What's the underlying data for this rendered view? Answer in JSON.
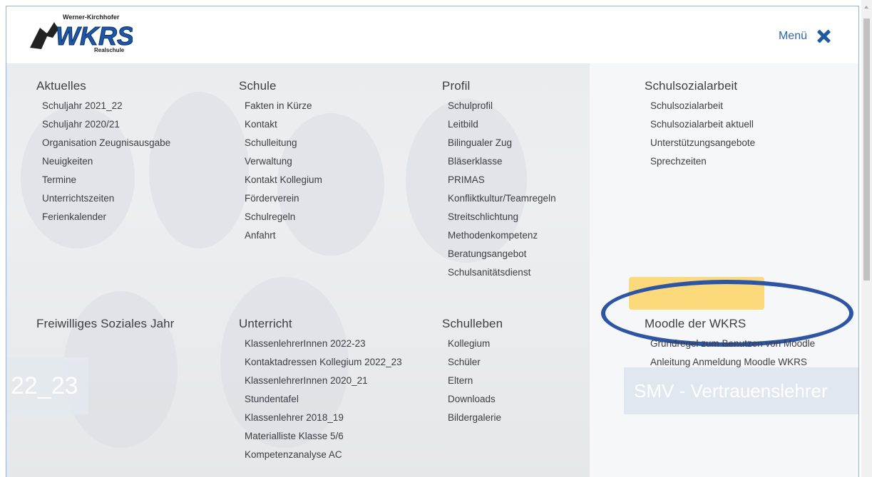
{
  "header": {
    "logo_text_top": "Werner-Kirchhofer",
    "logo_text_main": "WKRS",
    "logo_text_bottom": "Realschule",
    "menu_label": "Menü"
  },
  "columns": [
    {
      "title": "Aktuelles",
      "items": [
        "Schuljahr 2021_22",
        "Schuljahr 2020/21",
        "Organisation Zeugnisausgabe",
        "Neuigkeiten",
        "Termine",
        "Unterrichtszeiten",
        "Ferienkalender"
      ]
    },
    {
      "title": "Schule",
      "items": [
        "Fakten in Kürze",
        "Kontakt",
        "Schulleitung",
        "Verwaltung",
        "Kontakt Kollegium",
        "Förderverein",
        "Schulregeln",
        "Anfahrt"
      ]
    },
    {
      "title": "Profil",
      "items": [
        "Schulprofil",
        "Leitbild",
        "Bilingualer Zug",
        "Bläserklasse",
        "PRIMAS",
        "Konfliktkultur/Teamregeln",
        "Streitschlichtung",
        "Methodenkompetenz",
        "Beratungsangebot",
        "Schulsanitätsdienst"
      ]
    },
    {
      "title": "Schulsozialarbeit",
      "items": [
        "Schulsozialarbeit",
        "Schulsozialarbeit aktuell",
        "Unterstützungsangebote",
        "Sprechzeiten"
      ]
    },
    {
      "title": "Freiwilliges Soziales Jahr",
      "items": []
    },
    {
      "title": "Unterricht",
      "items": [
        "KlassenlehrerInnen 2022-23",
        "Kontaktadressen Kollegium 2022_23",
        "KlassenlehrerInnen 2020_21",
        "Stundentafel",
        "Klassenlehrer 2018_19",
        "Materialliste Klasse 5/6",
        "Kompetenzanalyse AC"
      ]
    },
    {
      "title": "Schulleben",
      "items": [
        "Kollegium",
        "Schüler",
        "Eltern",
        "Downloads",
        "Bildergalerie"
      ]
    },
    {
      "title": "Moodle der WKRS",
      "items": [
        "Grundregel zum Benutzen von Moodle",
        "Anleitung Anmeldung Moodle WKRS"
      ]
    }
  ],
  "promo": {
    "left_text": "22_23",
    "right_text": "SMV - Vertrauenslehrer"
  },
  "colors": {
    "accent": "#2d67a8",
    "highlight": "#fcd97a",
    "annotation": "#2e54a6"
  }
}
